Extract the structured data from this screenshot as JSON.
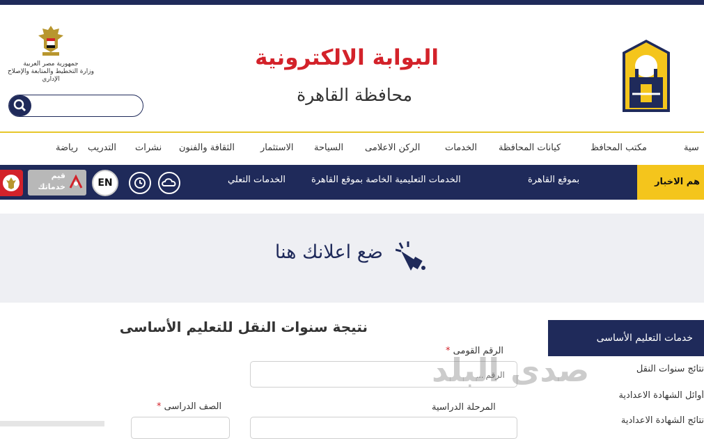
{
  "colors": {
    "navy": "#1f2a5a",
    "red": "#d3222a",
    "yellow": "#f4c51c",
    "ad_bg": "#eeeff3"
  },
  "header": {
    "title": "البوابة الالكترونية",
    "subtitle": "محافظة القاهرة",
    "ministry_line1": "جمهورية مصر العربية",
    "ministry_line2": "وزارة التخطيط والمتابعة والإصلاح الإداري",
    "search_placeholder": ""
  },
  "nav": {
    "items": [
      "سية",
      "مكتب المحافظ",
      "كيانات المحافظة",
      "الخدمات",
      "الركن الاعلامى",
      "السياحة",
      "الاستثمار",
      "الثقافة والفنون",
      "نشرات",
      "التدريب",
      "رياضة"
    ]
  },
  "ticker": {
    "label": "هم الاخبار",
    "items": [
      "بموقع القاهرة",
      "الخدمات التعليمية الخاصة بموقع القاهرة",
      "الخدمات التعلي"
    ]
  },
  "utility": {
    "rate_line1": "قيم",
    "rate_line2": "خدماتك",
    "en_label": "EN"
  },
  "ad": {
    "text": "ضع اعلانك هنا"
  },
  "form": {
    "title": "نتيجة سنوات النقل للتعليم الأساسى",
    "national_id_label": "الرقم القومى",
    "national_id_placeholder": "الرقم ...",
    "stage_label": "المرحلة الدراسية",
    "grade_label": "الصف الدراسى",
    "required_mark": "*"
  },
  "sidebar": {
    "heading": "خدمات التعليم الأساسى",
    "items": [
      "نتائج سنوات النقل",
      "أوائل الشهادة الاعدادية",
      "نتائج الشهادة الاعدادية"
    ]
  },
  "watermark": {
    "text": "صدى البلد"
  }
}
